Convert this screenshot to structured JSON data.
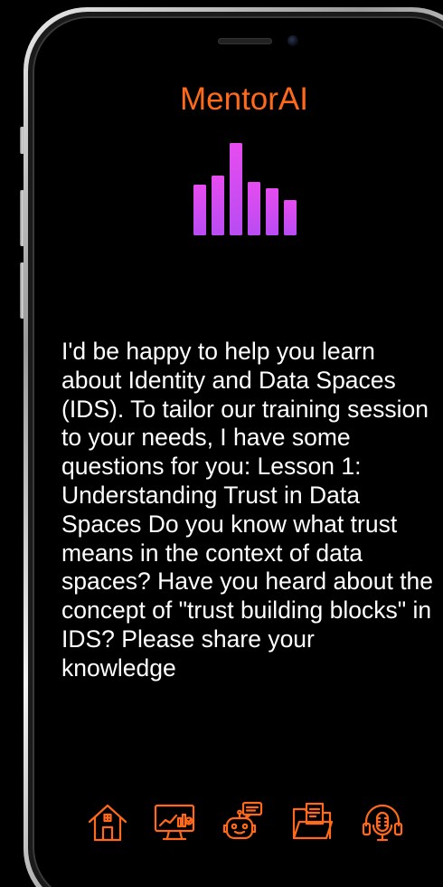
{
  "app": {
    "title": "MentorAI",
    "accent_color": "#ff6a1a",
    "visualizer_color": "#d44cf2",
    "visualizer_icon": "voice-equalizer-icon"
  },
  "message": {
    "text": "I'd be happy to help you learn about Identity and Data Spaces (IDS). To tailor our training session to your needs, I have some questions for you: Lesson 1: Understanding Trust in Data Spaces Do you know what trust means in the context of data spaces? Have you heard about the concept of \"trust building blocks\" in IDS? Please share your knowledge"
  },
  "dock": {
    "items": [
      {
        "icon": "home-icon"
      },
      {
        "icon": "dashboard-monitor-icon"
      },
      {
        "icon": "chatbot-icon"
      },
      {
        "icon": "folder-documents-icon"
      },
      {
        "icon": "podcast-headphones-icon"
      }
    ]
  }
}
